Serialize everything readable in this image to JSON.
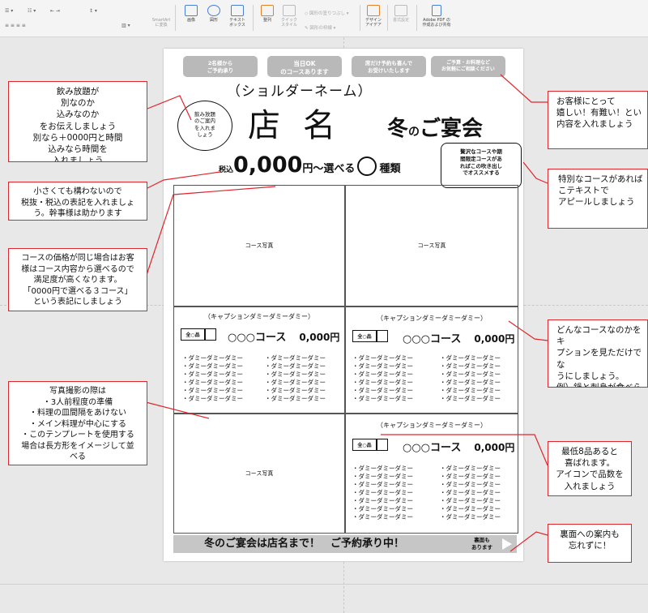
{
  "toolbar": {
    "buttons": [
      {
        "icon": "image-icon",
        "label": "画像"
      },
      {
        "icon": "shape-icon",
        "label": "図形"
      },
      {
        "icon": "textbox-icon",
        "label": "テキスト\nボックス"
      },
      {
        "icon": "arrange-icon",
        "label": "整列"
      },
      {
        "icon": "quick-style-icon",
        "label": "クイック\nスタイル"
      },
      {
        "icon": "design-ideas-icon",
        "label": "デザイン\nアイデア"
      },
      {
        "icon": "format-pane-icon",
        "label": "書式設定"
      },
      {
        "icon": "adobe-pdf-icon",
        "label": "Adobe PDF の\n作成および共有"
      }
    ],
    "smartart": "SmartArt\nに変換",
    "shape_fill": "図形の塗りつぶし",
    "shape_outline": "図形の枠線"
  },
  "flyer": {
    "pills": [
      "2名様から\nご予約承り",
      "当日OK\nのコースあります",
      "席だけ予約も喜んで\nお受けいたします",
      "ご予算・お料理など\nお気軽にご相談ください"
    ],
    "furigana": "（ショルダーネーム）",
    "bubble": "飲み放題\nのご案内\nを入れま\nしょう",
    "shop_name": "店名",
    "season_main": "冬",
    "season_small": "の",
    "season_rest": "ご宴会",
    "tax": "税込",
    "price": "0,000",
    "price_suffix": "円～選べる",
    "kinds": "種類",
    "special": "贅沢なコースや期\n間限定コースがあ\nればこの吹き出し\nでオススメする",
    "photo_label": "コース写真",
    "caption": "（キャプションダミーダミーダミー）",
    "badge": "全○品",
    "course_name": "○○○コース",
    "course_price": "0,000円",
    "dish": "・ダミーダミーダミー",
    "footer_text": "冬のご宴会は店名まで！　ご予約承り中！",
    "footer_note": "裏面も\nあります"
  },
  "notes": {
    "n1": "飲み放題が\n別なのか\n込みなのか\nをお伝えしましょう\n別なら＋0000円と時間\n込みなら時間を\n入れましょう",
    "n2": "小さくても構わないので\n税抜・税込の表記を入れましょ\nう。幹事様は助かります",
    "n3": "コースの価格が同じ場合はお客\n様はコース内容から選べるので\n満足度が高くなります。\n「0000円で選べる３コース」\nという表記にしましょう",
    "n4": "写真撮影の際は\n・3人前程度の準備\n・料理の皿間隔をあけない\n・メイン料理が中心にする\n・このテンプレートを使用する\n場合は長方形をイメージして並\nべる",
    "r1": "お客様にとって\n嬉しい！有難い！とい\n内容を入れましょう",
    "r2": "特別なコースがあれば\nこテキストで\nアピールしましょう",
    "r3": "どんなコースなのかをキ\nプションを見ただけでな\nうにしましょう。\n例）鍋と刺身が食べら\n大満足なコース",
    "r4": "最低8品あると\n喜ばれます。\nアイコンで品数を\n入れましょう",
    "r5": "裏面への案内も\n忘れずに！"
  },
  "colors": {
    "annotation": "#e0262d",
    "pill": "#b9b9b9",
    "footer": "#c6c6c6",
    "accent_icon": "#4a7fd1"
  }
}
